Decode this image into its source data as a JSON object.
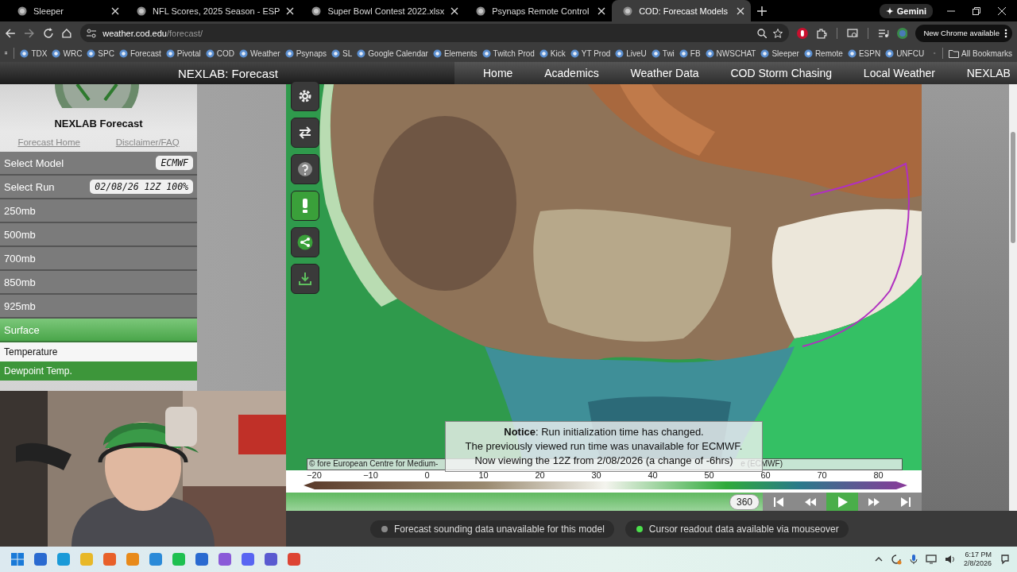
{
  "browser": {
    "tabs": [
      {
        "title": "Sleeper",
        "selected": false
      },
      {
        "title": "NFL Scores, 2025 Season - ESP",
        "selected": false
      },
      {
        "title": "Super Bowl Contest 2022.xlsx",
        "selected": false
      },
      {
        "title": "Psynaps Remote Control",
        "selected": false
      },
      {
        "title": "COD: Forecast Models",
        "selected": true
      }
    ],
    "gemini": "Gemini",
    "address": {
      "host": "weather.cod.edu",
      "path": "/forecast/"
    },
    "update_notice": "New Chrome available",
    "bookmarks": [
      "TDX",
      "WRC",
      "SPC",
      "Forecast",
      "Pivotal",
      "COD",
      "Weather",
      "Psynaps",
      "SL",
      "Google Calendar",
      "Elements",
      "Twitch Prod",
      "Kick",
      "YT Prod",
      "LiveU",
      "Twi",
      "FB",
      "NWSCHAT",
      "Sleeper",
      "Remote",
      "ESPN",
      "UNFCU"
    ],
    "all_bookmarks": "All Bookmarks"
  },
  "site": {
    "title": "NEXLAB: Forecast",
    "nav": [
      "Home",
      "Academics",
      "Weather Data",
      "COD Storm Chasing",
      "Local Weather",
      "NEXLAB"
    ]
  },
  "sidebar": {
    "heading": "NEXLAB Forecast",
    "links": [
      "Forecast Home",
      "Disclaimer/FAQ"
    ],
    "pickers": [
      {
        "label": "Select Model",
        "value": "ECMWF"
      },
      {
        "label": "Select Run",
        "value": "02/08/26 12Z 100%"
      }
    ],
    "levels": [
      {
        "label": "250mb",
        "selected": false
      },
      {
        "label": "500mb",
        "selected": false
      },
      {
        "label": "700mb",
        "selected": false
      },
      {
        "label": "850mb",
        "selected": false
      },
      {
        "label": "925mb",
        "selected": false
      },
      {
        "label": "Surface",
        "selected": true
      }
    ],
    "fields": [
      {
        "label": "Temperature",
        "selected": false
      },
      {
        "label": "Dewpoint Temp.",
        "selected": true
      }
    ]
  },
  "map": {
    "scale_ticks": [
      "−20",
      "−10",
      "0",
      "10",
      "20",
      "30",
      "40",
      "50",
      "60",
      "70",
      "80"
    ],
    "attribution": [
      "© fore European Centre for Medium-",
      "e (ECMWF)"
    ],
    "notice": [
      "**Notice**: Run initialization time has changed.",
      "The previously viewed run time was unavailable for ECMWF.",
      "Now viewing the 12Z from 2/08/2026 (a change of -6hrs)"
    ],
    "frame": "360",
    "statuses": [
      {
        "text": "Forecast sounding data unavailable for this model",
        "available": false
      },
      {
        "text": "Cursor readout data available via mouseover",
        "available": true
      }
    ]
  },
  "taskbar": {
    "time": "6:17 PM",
    "date": "2/8/2026"
  }
}
